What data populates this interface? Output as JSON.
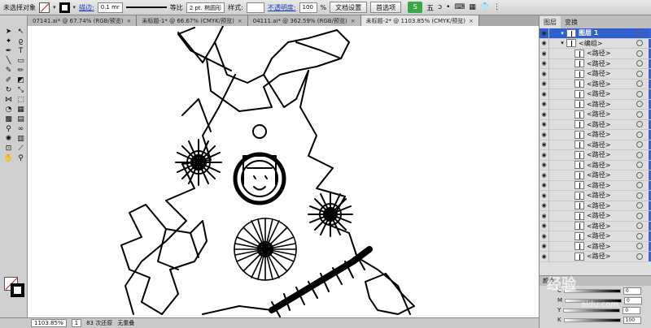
{
  "control_bar": {
    "selection_status": "未选择对象",
    "stroke_label": "描边:",
    "stroke_weight": "0.1 mr",
    "profile_label": "等比",
    "brush": "2 pt. 椭圆形",
    "style_label": "样式:",
    "opacity_label": "不透明度:",
    "opacity_value": "100",
    "opacity_unit": "%",
    "doc_setup_button": "文档设置",
    "prefs_button": "首选项"
  },
  "ime": {
    "logo": "S",
    "mode": "五",
    "punct": "ɔ",
    "dot": "•",
    "kbd": "⌨",
    "grid": "▦",
    "shirt": "👕",
    "menu": "⋮"
  },
  "tabs": [
    {
      "label": "07141.ai* @ 67.74% (RGB/预览)",
      "close": "×"
    },
    {
      "label": "未标题-1* @ 66.67% (CMYK/预览)",
      "close": "×"
    },
    {
      "label": "04111.ai* @ 362.59% (RGB/预览)",
      "close": "×"
    },
    {
      "label": "未标题-2* @ 1103.85% (CMYK/预览)",
      "close": "×"
    }
  ],
  "status_bar": {
    "zoom": "1103.85%",
    "page": "1",
    "history": "83 次还原",
    "artboard": "无重叠"
  },
  "layers_panel": {
    "tabs": [
      "图层",
      "变换"
    ],
    "layer_name": "图层 1",
    "group_name": "<编组>",
    "path_label": "<路径>",
    "path_count": 21
  },
  "color_panel": {
    "title": "颜色",
    "channels": [
      {
        "label": "C",
        "value": "0"
      },
      {
        "label": "M",
        "value": "0"
      },
      {
        "label": "Y",
        "value": "0"
      },
      {
        "label": "K",
        "value": "100"
      }
    ]
  },
  "watermark": {
    "text": "经验",
    "url": "aidu.com"
  },
  "colors": {
    "selection_blue": "#2f5fd0",
    "stroke": "#000000"
  }
}
